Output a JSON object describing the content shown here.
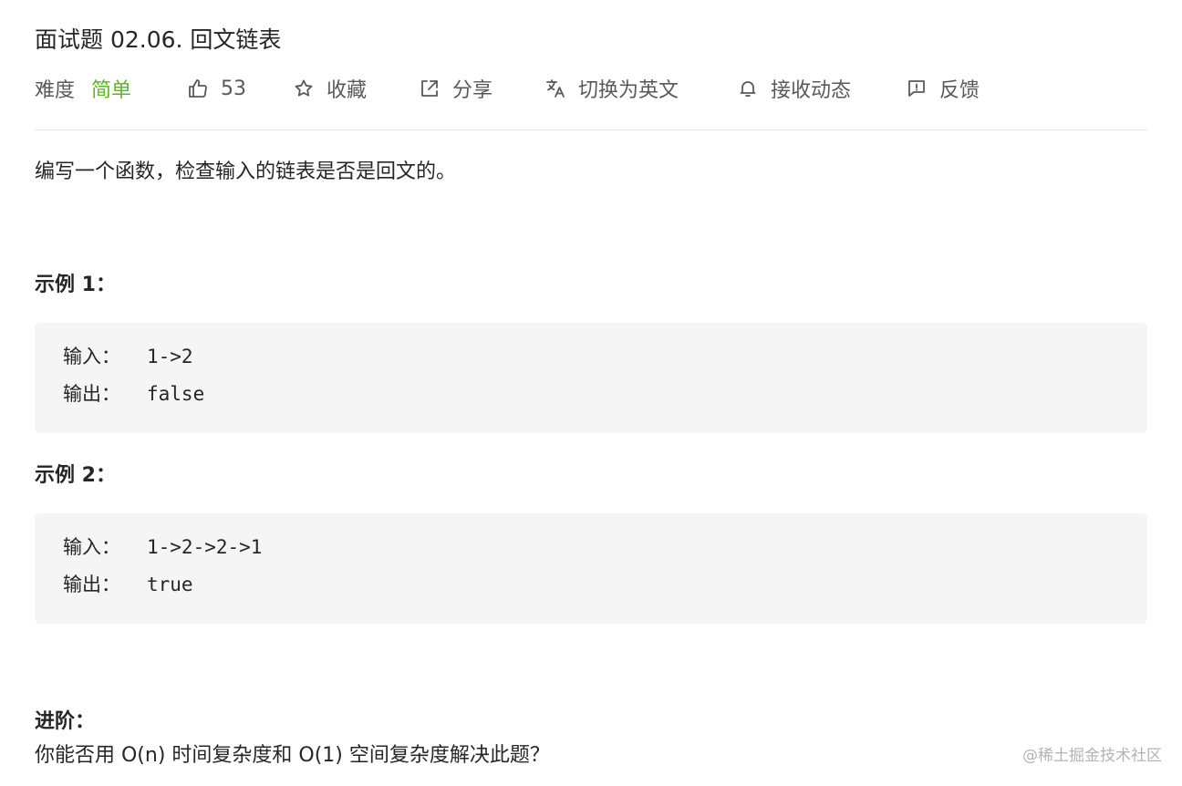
{
  "problem": {
    "title": "面试题 02.06. 回文链表",
    "difficulty_label": "难度",
    "difficulty_value": "简单",
    "likes": "53",
    "favorite_label": "收藏",
    "share_label": "分享",
    "switch_language_label": "切换为英文",
    "notify_label": "接收动态",
    "feedback_label": "反馈"
  },
  "description": "编写一个函数，检查输入的链表是否是回文的。",
  "examples": [
    {
      "heading": "示例 1：",
      "input_key": "输入：",
      "input_value": "1->2",
      "output_key": "输出：",
      "output_value": "false"
    },
    {
      "heading": "示例 2：",
      "input_key": "输入：",
      "input_value": "1->2->2->1",
      "output_key": "输出：",
      "output_value": "true"
    }
  ],
  "advanced": {
    "heading": "进阶：",
    "text": "你能否用 O(n) 时间复杂度和 O(1) 空间复杂度解决此题？"
  },
  "watermark": "@稀土掘金技术社区",
  "icons": {
    "like": "thumbs-up-icon",
    "favorite": "star-icon",
    "share": "share-icon",
    "translate": "translate-icon",
    "notify": "bell-icon",
    "feedback": "feedback-icon"
  },
  "colors": {
    "difficulty_easy": "#5ab726",
    "code_background": "#f5f5f5",
    "divider": "#e8e8e8"
  }
}
